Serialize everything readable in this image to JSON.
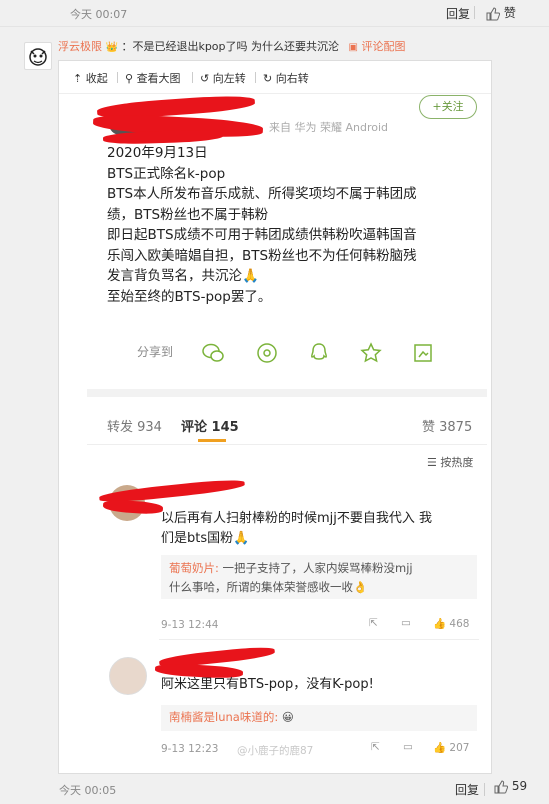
{
  "top": {
    "time": "今天 00:07",
    "reply": "回复",
    "like": "赞"
  },
  "comment": {
    "user": "浮云极限",
    "text": "：不是已经退出kpop了吗 为什么还要共沉沦",
    "pic_link": "评论配图"
  },
  "toolbar": {
    "collapse": "收起",
    "view_large": "查看大图",
    "rotate_left": "向左转",
    "rotate_right": "向右转"
  },
  "post": {
    "via": "来自 华为 荣耀 Android",
    "follow": "+关注",
    "lines": [
      "2020年9月13日",
      "BTS正式除名k-pop",
      "BTS本人所发布音乐成就、所得奖项均不属于韩团成",
      "绩，BTS粉丝也不属于韩粉",
      "即日起BTS成绩不可用于韩团成绩供韩粉吹逼韩国音",
      "乐闯入欧美暗娼自担，BTS粉丝也不为任何韩粉脑残",
      "发言背负骂名，共沉沦🙏",
      "至始至终的BTS-pop罢了。"
    ],
    "share_label": "分享到"
  },
  "stats": {
    "repost": "转发 934",
    "comments": "评论 145",
    "likes": "赞 3875",
    "sort": "按热度"
  },
  "comments": [
    {
      "text_line1": "以后再有人扫射棒粉的时候mjj不要自我代入 我",
      "text_line2": "们是bts国粉🙏",
      "reply_user": "葡萄奶片:",
      "reply_line1": " 一把子支持了，人家内娱骂棒粉没mjj",
      "reply_line2": "什么事哈，所谓的集体荣誉感收一收👌",
      "time": "9-13 12:44",
      "likes": "468"
    },
    {
      "text_line1": "阿米这里只有BTS-pop，没有K-pop!",
      "reply_user": "南楠酱是luna味道的:",
      "reply_emoji": "😀",
      "time": "9-13 12:23",
      "watermark": "@小鹿子的鹿87",
      "likes": "207"
    }
  ],
  "bottom": {
    "time": "今天 00:05",
    "reply": "回复",
    "like": "59"
  }
}
